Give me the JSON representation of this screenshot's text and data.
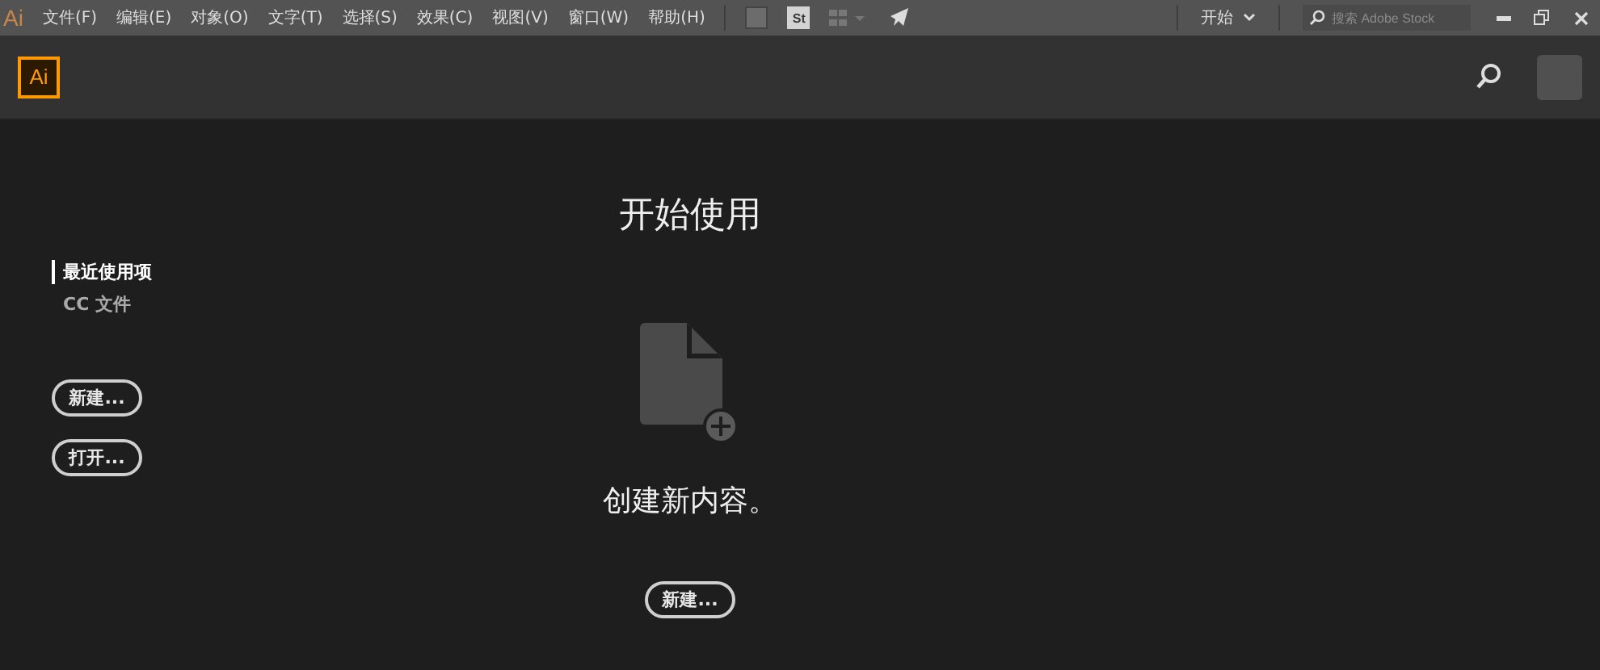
{
  "menu_bar": {
    "app_logo": "Ai",
    "menus": [
      "文件(F)",
      "编辑(E)",
      "对象(O)",
      "文字(T)",
      "选择(S)",
      "效果(C)",
      "视图(V)",
      "窗口(W)",
      "帮助(H)"
    ],
    "stock_badge": "St",
    "workspace": "开始",
    "search": {
      "placeholder": "搜索 Adobe Stock"
    }
  },
  "header": {
    "logo": "Ai"
  },
  "sidebar": {
    "items": [
      {
        "label": "最近使用项",
        "selected": true
      },
      {
        "label": "CC 文件",
        "selected": false
      }
    ],
    "buttons": [
      "新建...",
      "打开..."
    ]
  },
  "main": {
    "title": "开始使用",
    "message": "创建新内容。",
    "button": "新建..."
  }
}
